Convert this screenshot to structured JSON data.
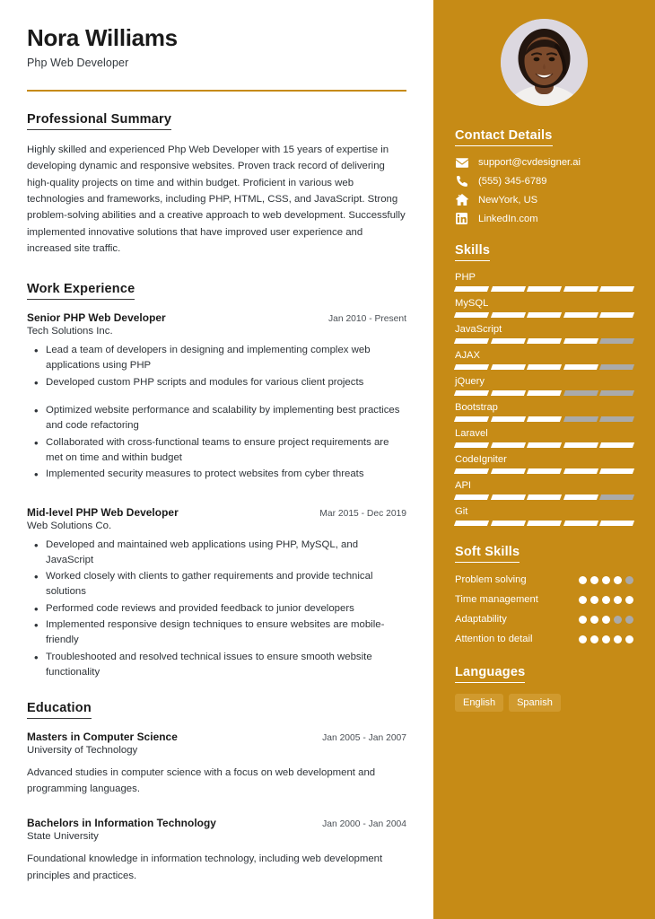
{
  "theme": {
    "accent": "#c68b16",
    "accent_light": "#d09a2e",
    "bar_off": "#aaaaaa",
    "text": "#2e3338"
  },
  "header": {
    "name": "Nora Williams",
    "title": "Php Web Developer"
  },
  "summary": {
    "heading": "Professional Summary",
    "text": "Highly skilled and experienced Php Web Developer with 15 years of expertise in developing dynamic and responsive websites. Proven track record of delivering high-quality projects on time and within budget. Proficient in various web technologies and frameworks, including PHP, HTML, CSS, and JavaScript. Strong problem-solving abilities and a creative approach to web development. Successfully implemented innovative solutions that have improved user experience and increased site traffic."
  },
  "experience": {
    "heading": "Work Experience",
    "entries": [
      {
        "role": "Senior PHP Web Developer",
        "date": "Jan 2010 - Present",
        "org": "Tech Solutions Inc.",
        "bullets": [
          "Lead a team of developers in designing and implementing complex web applications using PHP",
          "Developed custom PHP scripts and modules for various client projects",
          "Optimized website performance and scalability by implementing best practices and code refactoring",
          "Collaborated with cross-functional teams to ensure project requirements are met on time and within budget",
          "Implemented security measures to protect websites from cyber threats"
        ]
      },
      {
        "role": "Mid-level PHP Web Developer",
        "date": "Mar 2015 - Dec 2019",
        "org": "Web Solutions Co.",
        "bullets": [
          "Developed and maintained web applications using PHP, MySQL, and JavaScript",
          "Worked closely with clients to gather requirements and provide technical solutions",
          "Performed code reviews and provided feedback to junior developers",
          "Implemented responsive design techniques to ensure websites are mobile-friendly",
          "Troubleshooted and resolved technical issues to ensure smooth website functionality"
        ]
      }
    ]
  },
  "education": {
    "heading": "Education",
    "entries": [
      {
        "degree": "Masters in Computer Science",
        "date": "Jan 2005 - Jan 2007",
        "school": "University of Technology",
        "description": "Advanced studies in computer science with a focus on web development and programming languages."
      },
      {
        "degree": "Bachelors in Information Technology",
        "date": "Jan 2000 - Jan 2004",
        "school": "State University",
        "description": "Foundational knowledge in information technology, including web development principles and practices."
      }
    ]
  },
  "avatar": {
    "alt": "profile-photo"
  },
  "contact": {
    "heading": "Contact Details",
    "items": [
      {
        "icon": "envelope-icon",
        "value": "support@cvdesigner.ai"
      },
      {
        "icon": "phone-icon",
        "value": "(555) 345-6789"
      },
      {
        "icon": "home-icon",
        "value": "NewYork, US"
      },
      {
        "icon": "linkedin-icon",
        "value": "LinkedIn.com"
      }
    ]
  },
  "skills": {
    "heading": "Skills",
    "max": 5,
    "items": [
      {
        "name": "PHP",
        "level": 5
      },
      {
        "name": "MySQL",
        "level": 5
      },
      {
        "name": "JavaScript",
        "level": 4
      },
      {
        "name": "AJAX",
        "level": 4
      },
      {
        "name": "jQuery",
        "level": 3
      },
      {
        "name": "Bootstrap",
        "level": 3
      },
      {
        "name": "Laravel",
        "level": 5
      },
      {
        "name": "CodeIgniter",
        "level": 5
      },
      {
        "name": "API",
        "level": 4
      },
      {
        "name": "Git",
        "level": 5
      }
    ]
  },
  "soft_skills": {
    "heading": "Soft Skills",
    "max": 5,
    "items": [
      {
        "name": "Problem solving",
        "level": 4
      },
      {
        "name": "Time management",
        "level": 5
      },
      {
        "name": "Adaptability",
        "level": 3
      },
      {
        "name": "Attention to detail",
        "level": 5
      }
    ]
  },
  "languages": {
    "heading": "Languages",
    "items": [
      "English",
      "Spanish"
    ]
  }
}
